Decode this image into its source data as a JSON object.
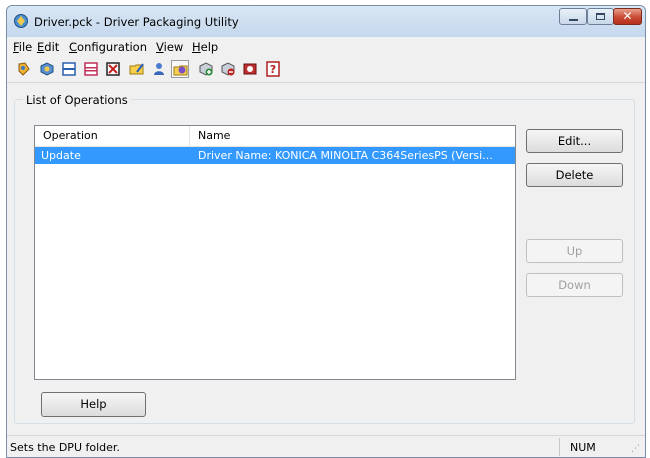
{
  "window": {
    "title": "Driver.pck - Driver Packaging Utility"
  },
  "menu": [
    "File",
    "Edit",
    "Configuration",
    "View",
    "Help"
  ],
  "toolbar": {
    "icons": [
      "new-icon",
      "open-icon",
      "save-icon",
      "save-as-icon",
      "close-file-icon",
      "folder-edit-icon",
      "user-icon",
      "dpu-folder-icon",
      "add-icon",
      "remove-icon",
      "install-icon",
      "help-icon"
    ]
  },
  "group": {
    "title": "List of Operations"
  },
  "list": {
    "columns": [
      "Operation",
      "Name"
    ],
    "rows": [
      {
        "operation": "Update",
        "name": "Driver Name: KONICA MINOLTA C364SeriesPS (Versi..."
      }
    ]
  },
  "buttons": {
    "edit": "Edit...",
    "delete": "Delete",
    "up": "Up",
    "down": "Down",
    "help": "Help"
  },
  "status": {
    "text": "Sets the DPU folder.",
    "num": "NUM"
  },
  "colors": {
    "selection": "#3399ff",
    "chrome": "#f0f0f0",
    "close": "#c84a32"
  }
}
